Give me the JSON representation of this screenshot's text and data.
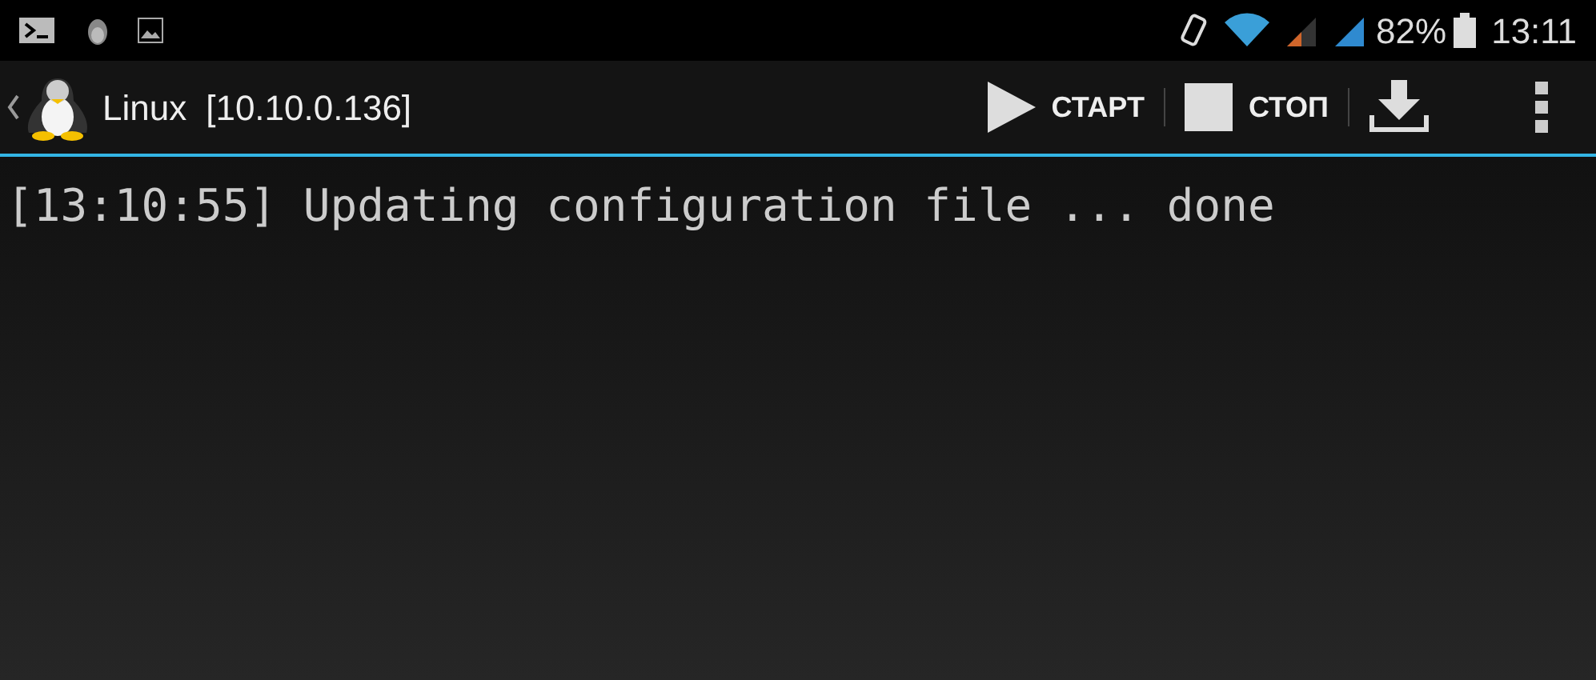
{
  "status_bar": {
    "battery": "82%",
    "time": "13:11"
  },
  "action_bar": {
    "title": "Linux",
    "subtitle": "[10.10.0.136]",
    "actions": [
      {
        "kind": "start",
        "label": "СТАРТ"
      },
      {
        "kind": "stop",
        "label": "СТОП"
      },
      {
        "kind": "download"
      },
      {
        "kind": "overflow"
      }
    ]
  },
  "log": [
    "[13:10:55] Updating configuration file ... done"
  ]
}
